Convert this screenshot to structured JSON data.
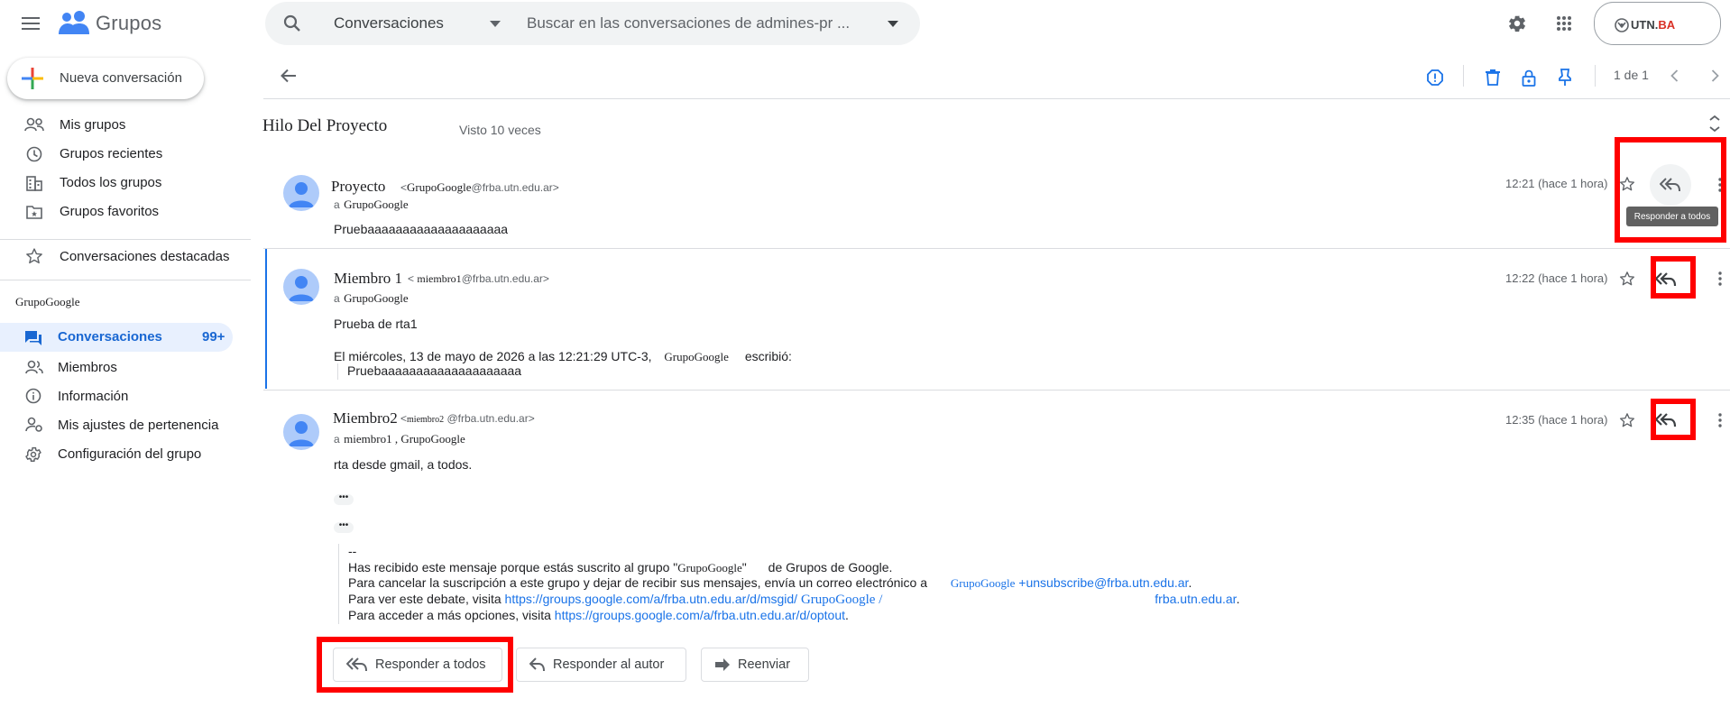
{
  "header": {
    "app_name": "Grupos",
    "search_scope": "Conversaciones",
    "search_placeholder": "Buscar en las conversaciones de admines-pr ...",
    "account_label": "UTN.BA",
    "account_label_part1": "UTN.",
    "account_label_part2": "BA"
  },
  "sidebar": {
    "new_conversation": "Nueva conversación",
    "items": [
      {
        "label": "Mis grupos",
        "icon": "people-icon"
      },
      {
        "label": "Grupos recientes",
        "icon": "clock-icon"
      },
      {
        "label": "Todos los grupos",
        "icon": "building-icon"
      },
      {
        "label": "Grupos favoritos",
        "icon": "folder-star-icon"
      }
    ],
    "starred": "Conversaciones destacadas",
    "group_name": "GrupoGoogle",
    "group_items": [
      {
        "label": "Conversaciones",
        "badge": "99+",
        "active": true
      },
      {
        "label": "Miembros"
      },
      {
        "label": "Información"
      },
      {
        "label": "Mis ajustes de pertenencia"
      },
      {
        "label": "Configuración del grupo"
      }
    ]
  },
  "toolbar": {
    "pagination": "1 de 1"
  },
  "thread": {
    "title": "Hilo Del Proyecto",
    "views": "Visto 10 veces",
    "messages": [
      {
        "sender": "Proyecto",
        "email_open": "<",
        "email_user": "GrupoGoogle",
        "email_domain": "@frba.utn.edu.ar>",
        "to_prefix": "a",
        "to": "GrupoGoogle",
        "time": "12:21 (hace 1 hora)",
        "body": "Pruebaaaaaaaaaaaaaaaaaaaa",
        "tooltip": "Responder a todos"
      },
      {
        "sender": "Miembro 1",
        "email_open": "<",
        "email_user": "miembro1",
        "email_domain": "@frba.utn.edu.ar>",
        "to_prefix": "a",
        "to": "GrupoGoogle",
        "time": "12:22 (hace 1 hora)",
        "body": "Prueba de rta1",
        "quote_header_pre": "El miércoles, 13 de mayo de 2026 a las 12:21:29 UTC-3,",
        "quote_header_group": "GrupoGoogle",
        "quote_header_post": "escribió:",
        "quote_body": "Pruebaaaaaaaaaaaaaaaaaaaa"
      },
      {
        "sender": "Miembro2",
        "email_open": "<",
        "email_user": "miembro2",
        "email_domain": "@frba.utn.edu.ar>",
        "to_prefix": "a",
        "to": "miembro1 , GrupoGoogle",
        "time": "12:35 (hace 1 hora)",
        "body": "rta desde gmail, a todos.",
        "ellipsis": "•••",
        "footer": {
          "dashes": "--",
          "line1_pre": "Has recibido este mensaje porque estás suscrito al grupo \"",
          "line1_group": "GrupoGoogle",
          "line1_quote": "\"",
          "line1_post": "de Grupos de Google.",
          "line2_pre": "Para cancelar la suscripción a este grupo y dejar de recibir sus mensajes, envía un correo electrónico a",
          "line2_group": "GrupoGoogle",
          "line2_link": "+unsubscribe@frba.utn.edu.ar",
          "line2_end": ".",
          "line3_pre": "Para ver este debate, visita",
          "line3_link": "https://groups.google.com/a/frba.utn.edu.ar/d/msgid/",
          "line3_group": "GrupoGoogle /",
          "line3_link2": "frba.utn.edu.ar",
          "line3_end": ".",
          "line4_pre": "Para acceder a más opciones, visita",
          "line4_link": "https://groups.google.com/a/frba.utn.edu.ar/d/optout",
          "line4_end": "."
        }
      }
    ]
  },
  "actions": {
    "reply_all": "Responder a todos",
    "reply_author": "Responder al autor",
    "forward": "Reenviar"
  },
  "colors": {
    "accent": "#1a73e8",
    "highlight_box": "#ff0000",
    "avatar_bg": "#aecbfa"
  }
}
